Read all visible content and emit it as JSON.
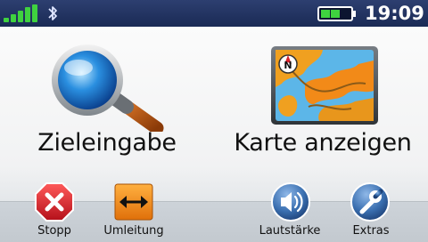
{
  "status_bar": {
    "signal_bars": 5,
    "bluetooth_icon": "bluetooth-icon",
    "battery_level": 0.65,
    "time": "19:09"
  },
  "main_menu": {
    "where_to": {
      "label": "Zieleingabe",
      "icon": "magnifier-icon"
    },
    "view_map": {
      "label": "Karte anzeigen",
      "icon": "map-icon"
    }
  },
  "toolbar": {
    "stop": {
      "label": "Stopp",
      "icon": "stop-icon"
    },
    "detour": {
      "label": "Umleitung",
      "icon": "detour-arrow-icon"
    },
    "volume": {
      "label": "Lautstärke",
      "icon": "speaker-icon"
    },
    "extras": {
      "label": "Extras",
      "icon": "wrench-icon"
    }
  },
  "colors": {
    "status_bar": "#1f2f5e",
    "signal": "#3fd23f",
    "battery": "#3fd23f",
    "stop_red": "#d8202a",
    "detour_orange": "#f08a10",
    "round_button_blue": "#3a6fb0"
  }
}
